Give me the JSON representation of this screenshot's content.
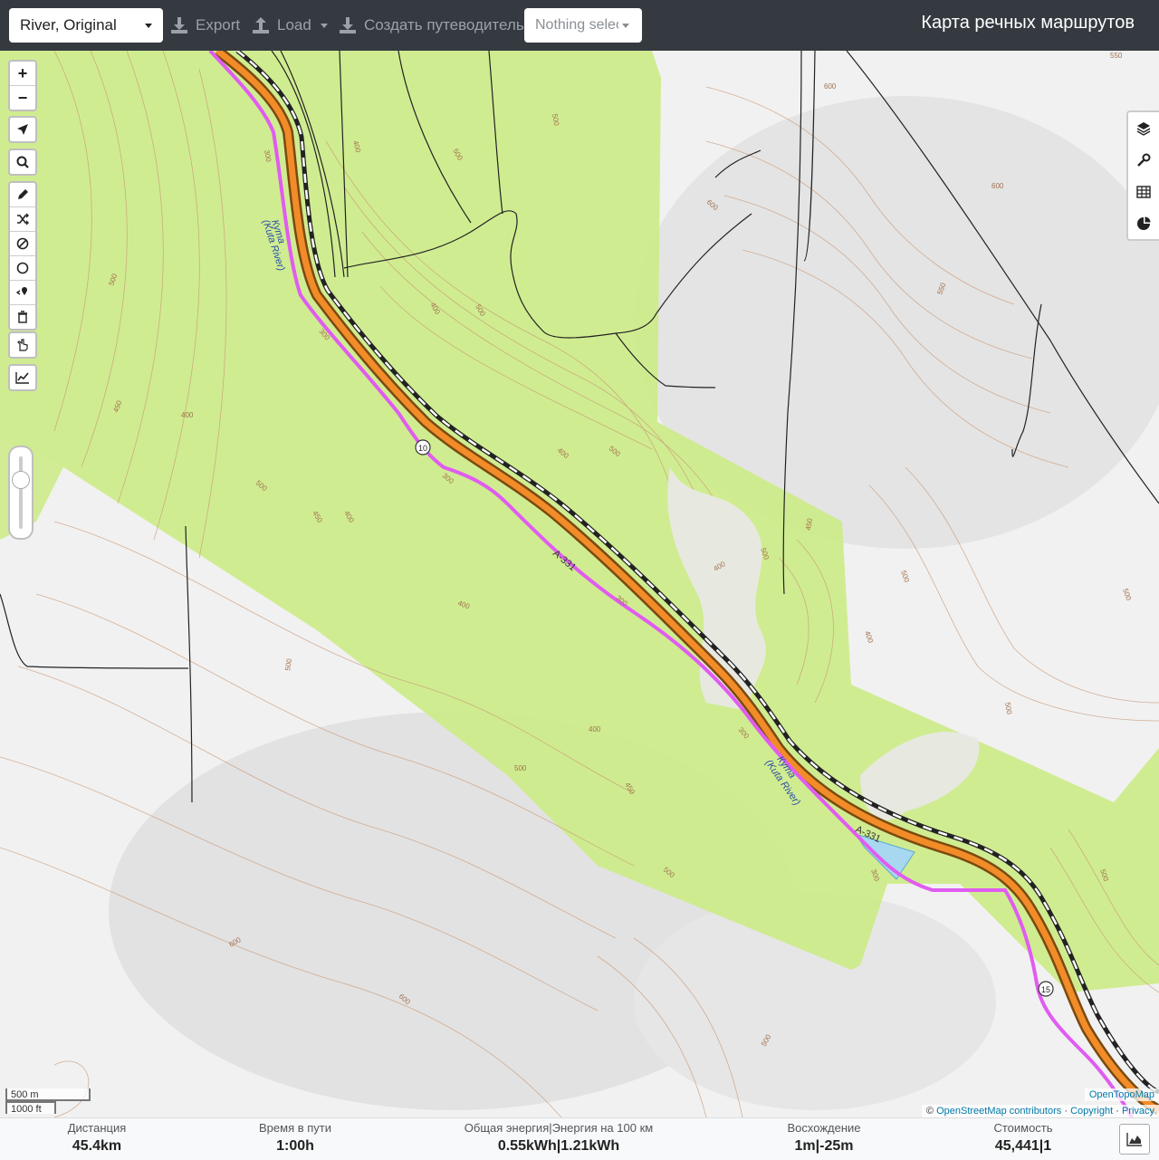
{
  "topbar": {
    "profile_value": "River, Original",
    "export_label": "Export",
    "load_label": "Load",
    "guide_label": "Создать путеводитель",
    "selection_value": "Nothing selected",
    "app_title": "Карта речных маршрутов"
  },
  "map": {
    "river_label_1": "Кута",
    "river_sub_1": "(Kuta River)",
    "river_label_2": "Кута",
    "river_sub_2": "(Kuta River)",
    "road_label_1": "A-331",
    "road_label_2": "A-331",
    "marker_1": "10",
    "marker_2": "15",
    "contour_labels": [
      "600",
      "600",
      "500",
      "550",
      "600",
      "550",
      "500",
      "500",
      "400",
      "400",
      "400",
      "500",
      "500",
      "450",
      "400",
      "500",
      "450",
      "400",
      "500",
      "450",
      "500",
      "500",
      "400",
      "400",
      "400",
      "500",
      "300",
      "300",
      "300",
      "300",
      "300",
      "300",
      "500",
      "400",
      "500",
      "600",
      "600",
      "500",
      "500",
      "450",
      "500"
    ],
    "colors": {
      "forest": "#cdeb8b",
      "route": "#e05cf0",
      "road_outer": "#7a4a10",
      "road_inner": "#f28c28",
      "contour": "#c79573",
      "water": "#a8d8f0",
      "rail": "#222222"
    }
  },
  "controls": {
    "zoom_in": "+",
    "zoom_out": "−"
  },
  "scale": {
    "metric": "500 m",
    "imperial": "1000 ft"
  },
  "attribution": {
    "tiles": "OpenTopoMap",
    "prefix": "©",
    "osm": "OpenStreetMap contributors",
    "sep": "·",
    "copyright": "Copyright",
    "privacy": "Privacy"
  },
  "footer": {
    "distance_label": "Дистанция",
    "distance_value": "45.4",
    "distance_unit": "km",
    "time_label": "Время в пути",
    "time_value": "1:00",
    "time_unit": "h",
    "energy_label": "Общая энергия|Энергия на 100 км",
    "energy_total": "0.55",
    "energy_total_unit": "kWh",
    "energy_sep": "|",
    "energy_per100": "1.21",
    "energy_per100_unit": "kWh",
    "ascent_label": "Восхождение",
    "ascent_up": "1",
    "ascent_up_unit": "m",
    "ascent_sep": "|",
    "ascent_down": "-25",
    "ascent_down_unit": "m",
    "cost_label": "Стоимость",
    "cost_value": "45,441",
    "cost_sep": "|",
    "cost_count": "1"
  }
}
